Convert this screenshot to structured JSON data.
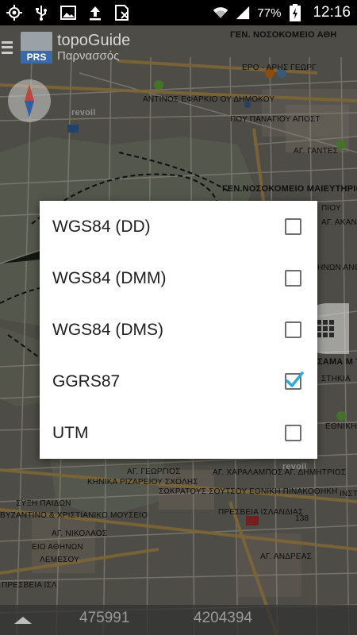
{
  "status_bar": {
    "icons_left": [
      "gps-icon",
      "usb-icon",
      "image-icon",
      "upload-icon",
      "no-sim-icon"
    ],
    "battery_percent": "77%",
    "time": "12:16"
  },
  "app": {
    "title": "topoGuide",
    "subtitle": "Παρνασσός",
    "logo_text": "PRS"
  },
  "map": {
    "labels": [
      "ΓΕΝ. ΝΟΣΟΚΟΜΕΙΟ ΑΘΗ",
      "ΕΡΟ - ΑΡΗΣ ΓΕΩΡΓ",
      "ΑΝΤΙΝΟΣ ΕΦΑΡΚΙΟ ΟΥ ΔΗΜΟΚΟΥ",
      "ΠΟΥ ΠΑΝΑΓΙΟΥ ΑΠΟΣΤ",
      "ΑΓ. ΓΑΝΤΕΣ",
      "ΓΕΝ.ΝΟΣΟΚΟΜΕΙΟ ΜΑΙΕΥΤΗΡΙΟ",
      "ΠΙΟΥ",
      "ΑΓ. ΑΚΑΝΘΟ",
      "ΗΝΩΝ ΑΝΘΡΩΠΟ",
      "ΣΑΜΑ Μ Τ",
      "ΣΤΗΚΙΑ",
      "ΕΘΝΙΚΗ",
      "ΑΓ. ΓΕΩΡΓΙΟΣ",
      "ΑΓ. ΧΑΡΑΛΑΜΠΟΣ ΑΓ. ΔΗΜΗΤΡΙΟΣ",
      "ΚΗΝΙΚΑ ΡΙΖΑΡΕΙΟΥ ΣΧΟΛΗΣ",
      "ΣΩΚΡΑΤΟΥΣ ΣΟΥΤΣΟΥ ΕΘΝΙΚΗ ΠΙΝΑΚΟΘΗΚΗ",
      "ΣΥΞΗ ΠΑΙΔΩΝ",
      "ΒΥΖΑΝΤΙΝΟ & ΧΡΙΣΤΙΑΝΙΚΟ ΜΟΥΣΕΙΟ",
      "ΠΡΕΣΒΕΙΑ ΙΣΛΑΝΔΙΑΣ",
      "ΑΓ. ΝΙΚΟΛΑΟΣ",
      "ΕΙΟ ΑΘΗΝΩΝ",
      "ΛΕΜΕΣΟΥ",
      "ΑΓ. ΑΝΔΡΕΑΣ",
      "ΠΡΕΣΒΕΙΑ ΙΣΛ",
      "ΙΝΣΤΙ",
      "revoil",
      "revoil",
      "138"
    ]
  },
  "dialog": {
    "options": [
      {
        "label": "WGS84 (DD)",
        "checked": false
      },
      {
        "label": "WGS84 (DMM)",
        "checked": false
      },
      {
        "label": "WGS84 (DMS)",
        "checked": false
      },
      {
        "label": "GGRS87",
        "checked": true
      },
      {
        "label": "UTM",
        "checked": false
      }
    ]
  },
  "bottom_bar": {
    "coord_x": "475991",
    "coord_y": "4204394"
  },
  "colors": {
    "checkbox_check": "#2fa8d8",
    "dialog_background": "#ffffff",
    "status_bar": "#000000"
  }
}
